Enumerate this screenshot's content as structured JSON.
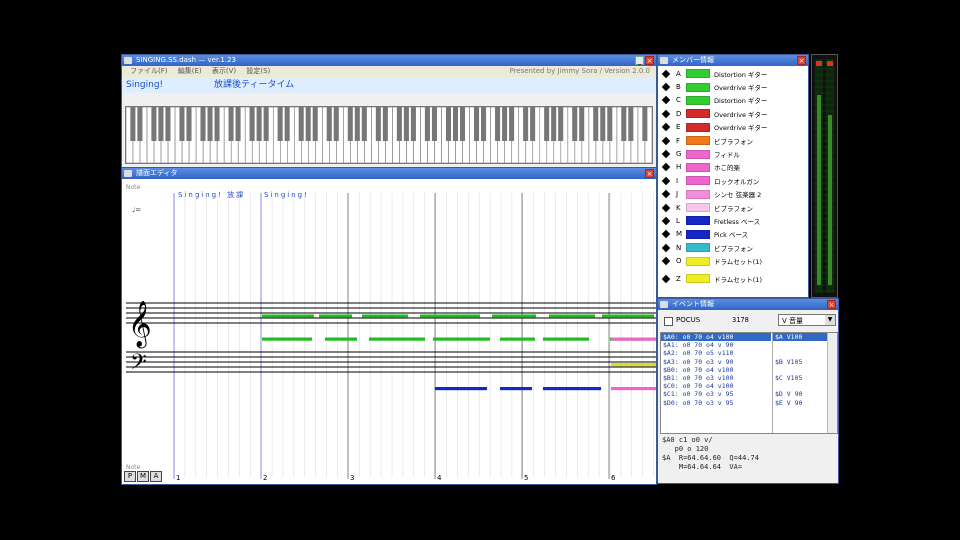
{
  "main_window": {
    "title": "SINGING.SS.dash — ver.1.23",
    "menu": [
      "ファイル(F)",
      "編集(E)",
      "表示(V)",
      "設定(S)"
    ],
    "credit": "Presented by Jimmy Sora / Version 2.0.0",
    "song_part": "Singing!",
    "song_title": "放課後ティータイム"
  },
  "score_window": {
    "title": "譜面エディタ",
    "measure_texts": [
      "Singing! 放課",
      "Singing!"
    ],
    "measure_numbers": [
      "1",
      "2",
      "3",
      "4",
      "5",
      "6"
    ],
    "top_label": "Note",
    "tempo_label": "♩=",
    "bottom_label": "Note",
    "mode_buttons": [
      "P",
      "M",
      "A"
    ]
  },
  "member_window": {
    "title": "メンバー情報",
    "members": [
      {
        "letter": "A",
        "color": "#33cc33",
        "name": "Distortion ギター"
      },
      {
        "letter": "B",
        "color": "#33cc33",
        "name": "Overdrive ギター"
      },
      {
        "letter": "C",
        "color": "#33cc33",
        "name": "Distortion ギター"
      },
      {
        "letter": "D",
        "color": "#d42a2a",
        "name": "Overdrive ギター"
      },
      {
        "letter": "E",
        "color": "#d42a2a",
        "name": "Overdrive ギター"
      },
      {
        "letter": "F",
        "color": "#f07818",
        "name": "ビブラフォン"
      },
      {
        "letter": "G",
        "color": "#ee66cc",
        "name": "フィドル"
      },
      {
        "letter": "H",
        "color": "#ee66cc",
        "name": "ホこ的楽"
      },
      {
        "letter": "I",
        "color": "#ee66cc",
        "name": "ロックオルガン"
      },
      {
        "letter": "J",
        "color": "#f28cdc",
        "name": "シンセ 弦楽器 2"
      },
      {
        "letter": "K",
        "color": "#f8c8ec",
        "name": "ビブラフォン"
      },
      {
        "letter": "L",
        "color": "#1428c8",
        "name": "Fretless ベース"
      },
      {
        "letter": "M",
        "color": "#1428c8",
        "name": "Pick ベース"
      },
      {
        "letter": "N",
        "color": "#33bbcc",
        "name": "ビブラフォン"
      },
      {
        "letter": "O",
        "color": "#eeee22",
        "name": "ドラムセット(1)"
      },
      {
        "letter": "Z",
        "color": "#eeee22",
        "name": "ドラムセット(1)"
      }
    ]
  },
  "info_window": {
    "title": "イベント情報",
    "pocus_label": "POCUS",
    "time_value": "3178",
    "select_value": "V 音量",
    "events_left": [
      "$A0: o0 70 o4 v100",
      "$A1: o0 70 o4 v 90",
      "$A2: o0 70 o5 v110",
      "$A3: o0 70 o3 v 90",
      "$B0: o0 70 o4 v100",
      "$B1: o0 70 o3 v100",
      "$C0: o0 70 o4 v100",
      "$C1: o0 70 o3 v 95",
      "$D0: o0 70 o3 v 95"
    ],
    "events_right": [
      "$A V100",
      "",
      "",
      "$B V105",
      "",
      "$C V105",
      "",
      "$D V 90",
      "$E V 90"
    ],
    "status_lines": [
      "$A0 c1 o0 v/",
      "   p0 o 120",
      "$A  R=64.64.60  Q=44.74",
      "    M=64.64.64  VA="
    ]
  },
  "colors": {
    "guitar_green": "#22bb22",
    "bass_blue": "#1428c8",
    "drum_yellow": "#dddd22",
    "synth_pink": "#ee66cc",
    "title_blue": "#3264c8"
  }
}
